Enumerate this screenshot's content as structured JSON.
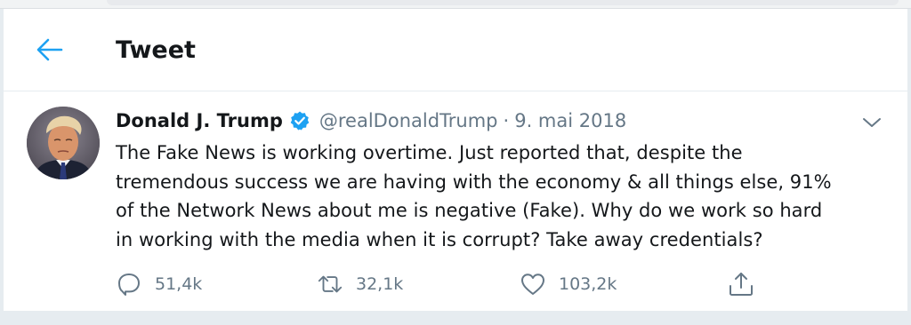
{
  "header": {
    "title": "Tweet"
  },
  "tweet": {
    "author_name": "Donald J. Trump",
    "handle": "@realDonaldTrump",
    "separator": "·",
    "date": "9. mai 2018",
    "text": "The Fake News is working overtime. Just reported that, despite the\ntremendous success we are having with the economy & all things else, 91%\nof the Network News about me is negative (Fake). Why do we work so hard\nin working with the media when it is corrupt? Take away credentials?",
    "verified": true
  },
  "actions": {
    "reply_count": "51,4k",
    "retweet_count": "32,1k",
    "like_count": "103,2k"
  },
  "icons": {
    "back": "arrow-left-icon",
    "verified": "verified-badge-icon",
    "caret": "chevron-down-icon",
    "reply": "reply-icon",
    "retweet": "retweet-icon",
    "like": "heart-icon",
    "share": "share-icon"
  },
  "colors": {
    "accent": "#1da1f2",
    "text": "#14171a",
    "secondary": "#657786",
    "page_background": "#e6ecf0"
  }
}
